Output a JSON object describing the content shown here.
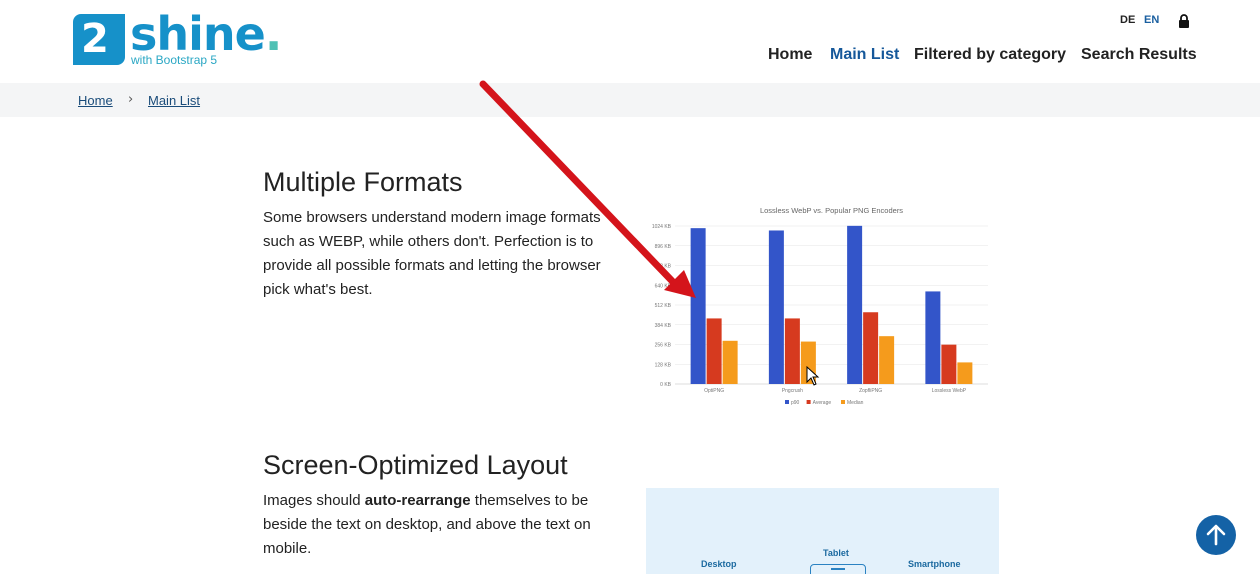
{
  "brand": {
    "badge": "2",
    "name": "shine",
    "dot": ".",
    "tagline": "with Bootstrap 5"
  },
  "lang": {
    "de": "DE",
    "en": "EN"
  },
  "nav": {
    "home": "Home",
    "main_list": "Main List",
    "filtered": "Filtered by category",
    "search": "Search Results"
  },
  "breadcrumb": {
    "home": "Home",
    "sep": "›",
    "main_list": "Main List"
  },
  "section1": {
    "title": "Multiple Formats",
    "text": "Some browsers understand modern image formats such as WEBP, while others don't. Perfection is to provide all possible formats and letting the browser pick what's best."
  },
  "section2": {
    "title": "Screen-Optimized Layout",
    "text_before": "Images should ",
    "text_bold": "auto-rearrange",
    "text_after": " themselves to be beside the text on desktop, and above the text on mobile.",
    "devices": {
      "desktop": "Desktop",
      "tablet": "Tablet",
      "smartphone": "Smartphone"
    }
  },
  "colors": {
    "accent": "#16589a",
    "brand": "#1691c9",
    "arrow": "#d4141b",
    "p90": "#3355c9",
    "avg": "#d63a1f",
    "median": "#f59b1c"
  },
  "icons": {
    "lock": "lock-icon",
    "up": "arrow-up-icon",
    "cursor": "mouse-cursor-icon"
  },
  "chart_data": {
    "type": "bar",
    "title": "Lossless WebP vs. Popular PNG Encoders",
    "categories": [
      "OptiPNG",
      "Pngcrush",
      "ZopfliPNG",
      "Lossless WebP"
    ],
    "series": [
      {
        "name": "p90",
        "values": [
          1010,
          995,
          1025,
          600
        ]
      },
      {
        "name": "Average",
        "values": [
          425,
          425,
          465,
          255
        ]
      },
      {
        "name": "Median",
        "values": [
          280,
          275,
          310,
          140
        ]
      }
    ],
    "yticks": [
      "0 KB",
      "128 KB",
      "256 KB",
      "384 KB",
      "512 KB",
      "640 KB",
      "768 KB",
      "896 KB",
      "1024 KB"
    ],
    "ylim": [
      0,
      1024
    ],
    "grid": true,
    "legend": "bottom"
  }
}
